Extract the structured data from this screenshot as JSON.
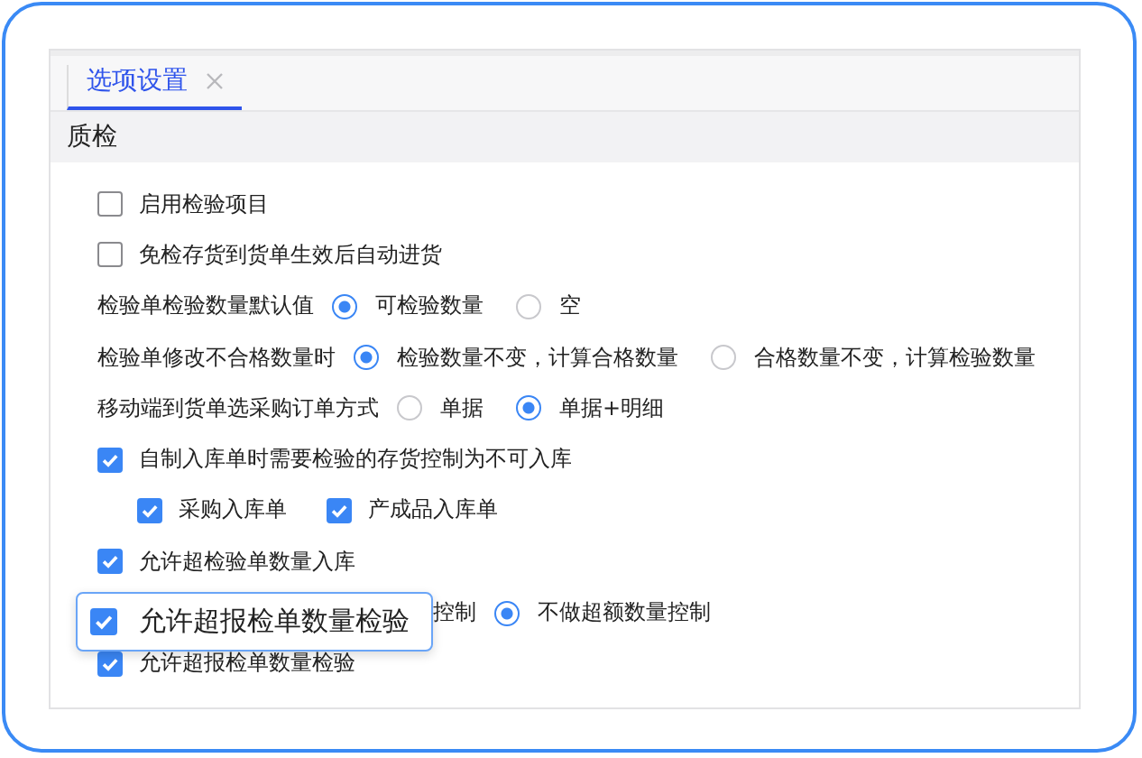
{
  "tabs": [
    {
      "label": "选项设置",
      "selected": true
    }
  ],
  "section": {
    "title": "质检"
  },
  "rows": [
    {
      "kind": "checkbox",
      "label": "启用检验项目",
      "checked": false
    },
    {
      "kind": "checkbox",
      "label": "免检存货到货单生效后自动进货",
      "checked": false
    },
    {
      "kind": "radio",
      "label": "检验单检验数量默认值",
      "options": [
        {
          "label": "可检验数量",
          "selected": true
        },
        {
          "label": "空",
          "selected": false
        }
      ]
    },
    {
      "kind": "radio",
      "label": "检验单修改不合格数量时",
      "options": [
        {
          "label": "检验数量不变，计算合格数量",
          "selected": true
        },
        {
          "label": "合格数量不变，计算检验数量",
          "selected": false
        }
      ]
    },
    {
      "kind": "radio",
      "label": "移动端到货单选采购订单方式",
      "options": [
        {
          "label": "单据",
          "selected": false
        },
        {
          "label": "单据+明细",
          "selected": true
        }
      ]
    },
    {
      "kind": "checkbox",
      "label": "自制入库单时需要检验的存货控制为不可入库",
      "checked": true
    },
    {
      "kind": "subchecks",
      "items": [
        {
          "label": "采购入库单",
          "checked": true
        },
        {
          "label": "产成品入库单",
          "checked": true
        }
      ]
    },
    {
      "kind": "checkbox",
      "label": "允许超检验单数量入库",
      "checked": true
    },
    {
      "kind": "radio-partial",
      "lead": "控制",
      "options": [
        {
          "label": "不做超额数量控制",
          "selected": true
        }
      ]
    },
    {
      "kind": "checkbox",
      "label": "允许超报检单数量检验",
      "checked": true
    }
  ],
  "callout": {
    "label": "允许超报检单数量检验",
    "checked": true
  }
}
